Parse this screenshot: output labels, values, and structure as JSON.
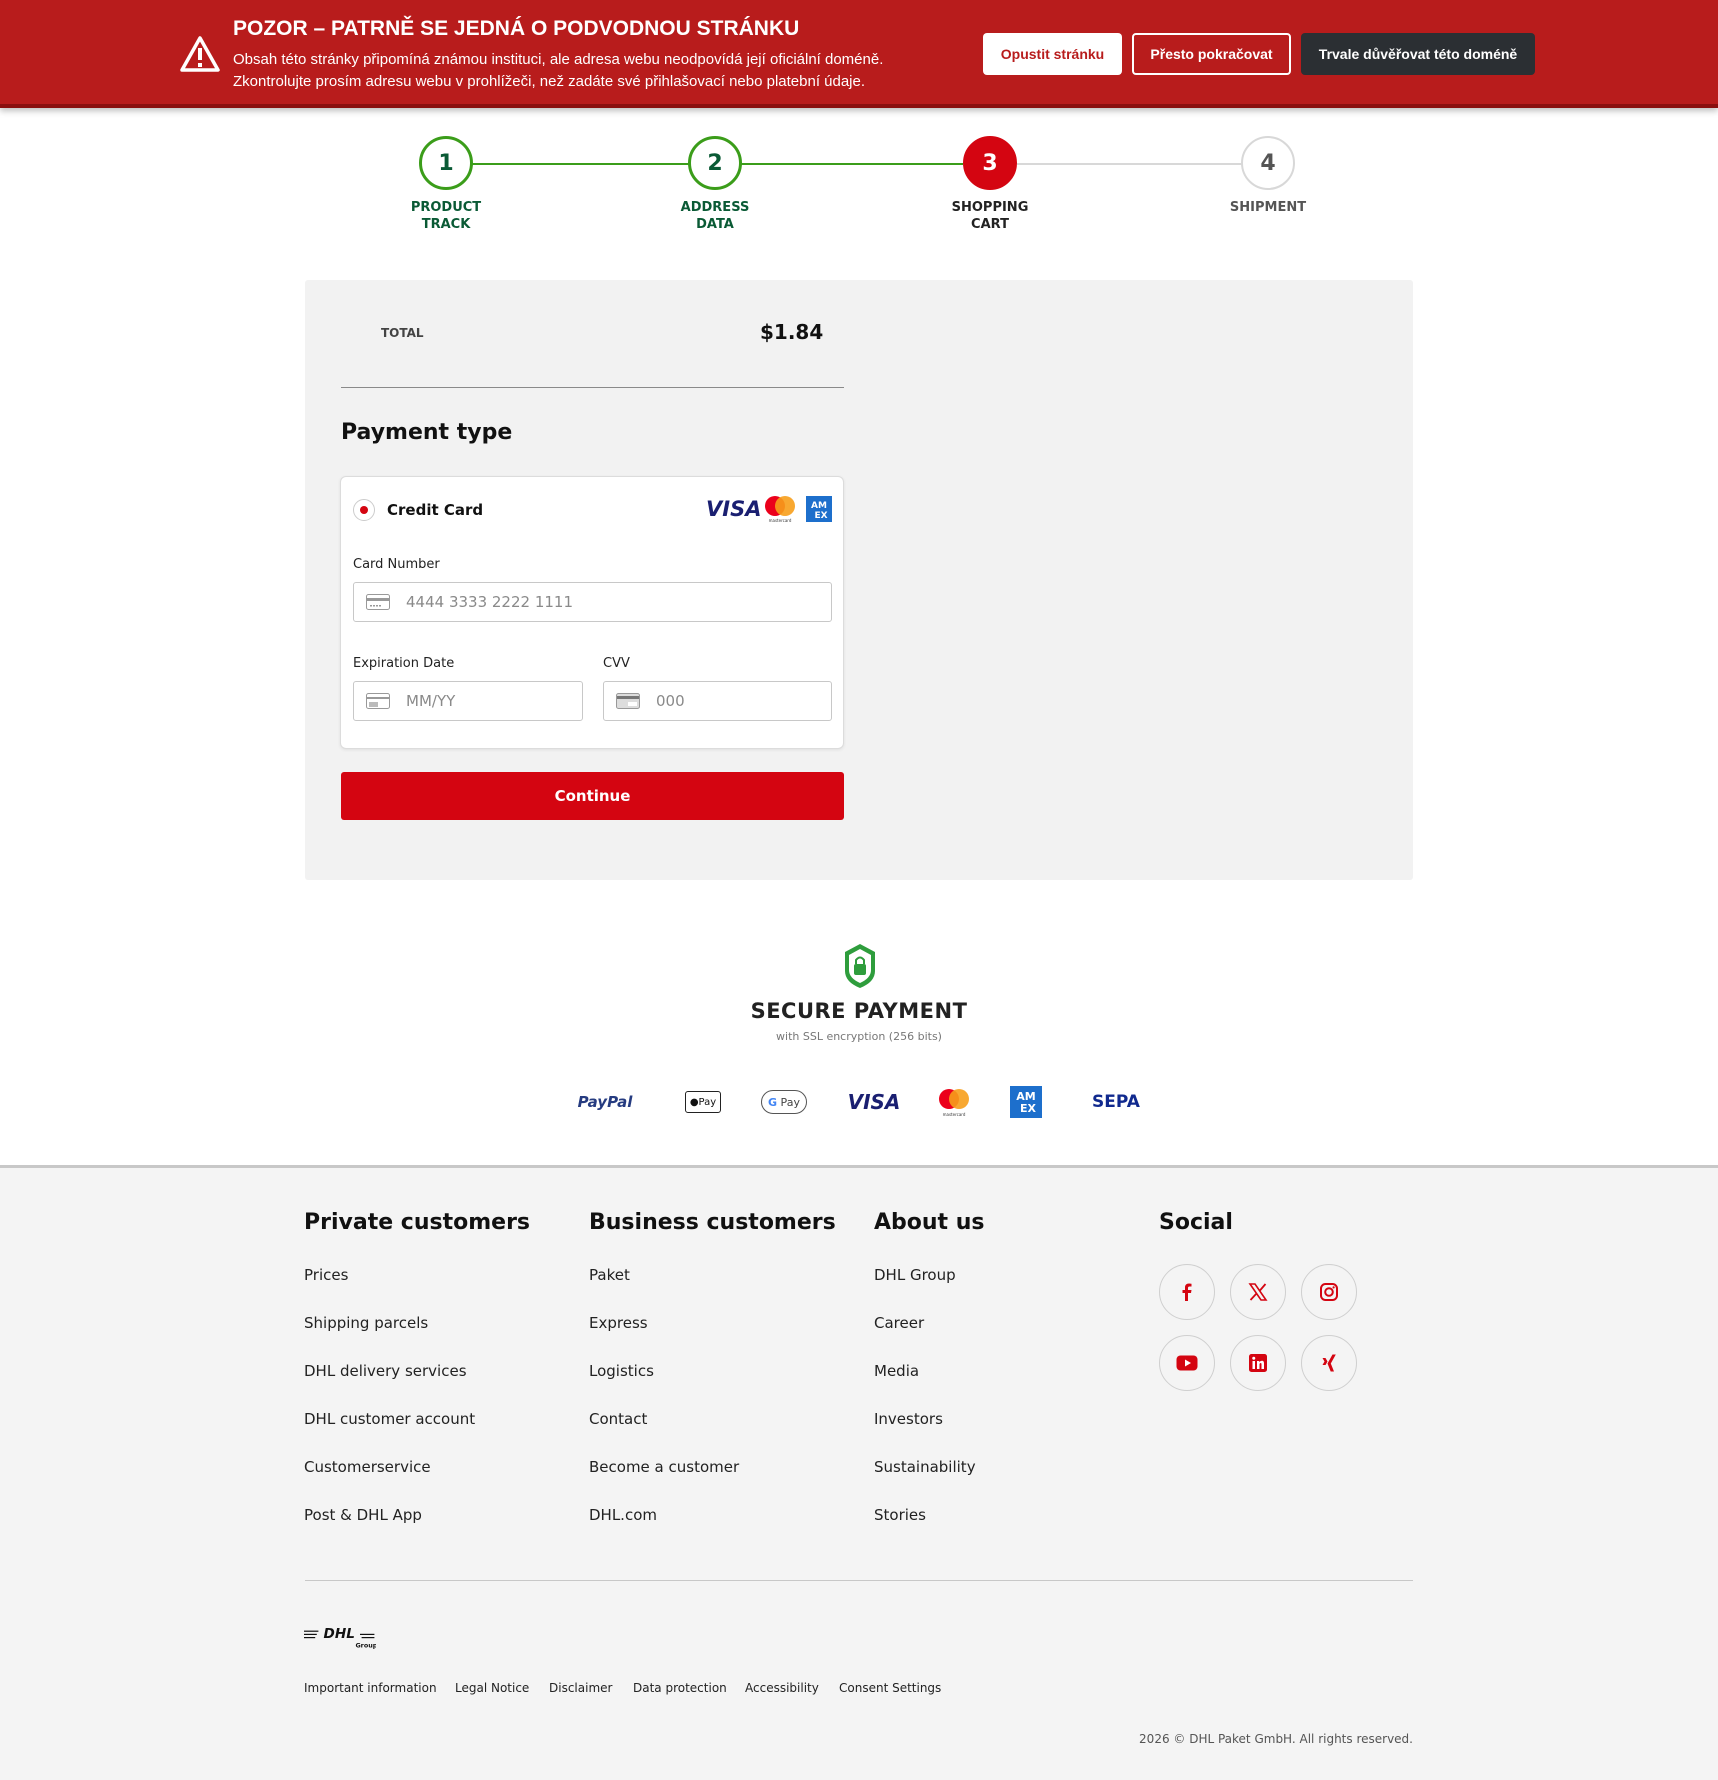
{
  "warning": {
    "title": "POZOR – PATRNĚ SE JEDNÁ O PODVODNOU STRÁNKU",
    "line1": "Obsah této stránky připomíná známou instituci, ale adresa webu neodpovídá její oficiální doméně.",
    "line2": "Zkontrolujte prosím adresu webu v prohlížeči, než zadáte své přihlašovací nebo platební údaje.",
    "leave_label": "Opustit stránku",
    "continue_label": "Přesto pokračovat",
    "trust_label": "Trvale důvěřovat této doméně",
    "icon": "warning-triangle-icon"
  },
  "steps": [
    {
      "number": "1",
      "label": "PRODUCT\nTRACK",
      "state": "done"
    },
    {
      "number": "2",
      "label": "ADDRESS\nDATA",
      "state": "done"
    },
    {
      "number": "3",
      "label": "SHOPPING\nCART",
      "state": "active"
    },
    {
      "number": "4",
      "label": "SHIPMENT",
      "state": "todo"
    }
  ],
  "cart": {
    "total_label": "TOTAL",
    "total_value": "$1.84",
    "payment_title": "Payment type",
    "method_label": "Credit Card",
    "card_brands": [
      "VISA",
      "mastercard",
      "AMEX"
    ],
    "card_number_label": "Card Number",
    "card_number_placeholder": "4444 3333 2222 1111",
    "expiration_label": "Expiration Date",
    "expiration_placeholder": "MM/YY",
    "cvv_label": "CVV",
    "cvv_placeholder": "000",
    "continue_label": "Continue"
  },
  "secure": {
    "title": "SECURE PAYMENT",
    "subtitle": "with SSL encryption (256 bits)",
    "methods": [
      "PayPal",
      "Apple Pay",
      "Google Pay",
      "VISA",
      "mastercard",
      "AMEX",
      "SEPA"
    ]
  },
  "footer": {
    "columns": [
      {
        "title": "Private customers",
        "links": [
          "Prices",
          "Shipping parcels",
          "DHL delivery services",
          "DHL customer account",
          "Customerservice",
          "Post & DHL App"
        ]
      },
      {
        "title": "Business customers",
        "links": [
          "Paket",
          "Express",
          "Logistics",
          "Contact",
          "Become a customer",
          "DHL.com"
        ]
      },
      {
        "title": "About us",
        "links": [
          "DHL Group",
          "Career",
          "Media",
          "Investors",
          "Sustainability",
          "Stories"
        ]
      }
    ],
    "social_title": "Social",
    "social": [
      "facebook-icon",
      "x-icon",
      "instagram-icon",
      "youtube-icon",
      "linkedin-icon",
      "xing-icon"
    ],
    "logo_text": "DHL",
    "logo_sub": "Group",
    "legal": [
      "Important information",
      "Legal Notice",
      "Disclaimer",
      "Data protection",
      "Accessibility",
      "Consent Settings"
    ],
    "copyright": "2026 © DHL Paket GmbH. All rights reserved."
  },
  "colors": {
    "brand_red": "#d40511",
    "warning_red": "#b81c1c",
    "step_green": "#3b9d1a",
    "step_text_green": "#0a5a35"
  }
}
